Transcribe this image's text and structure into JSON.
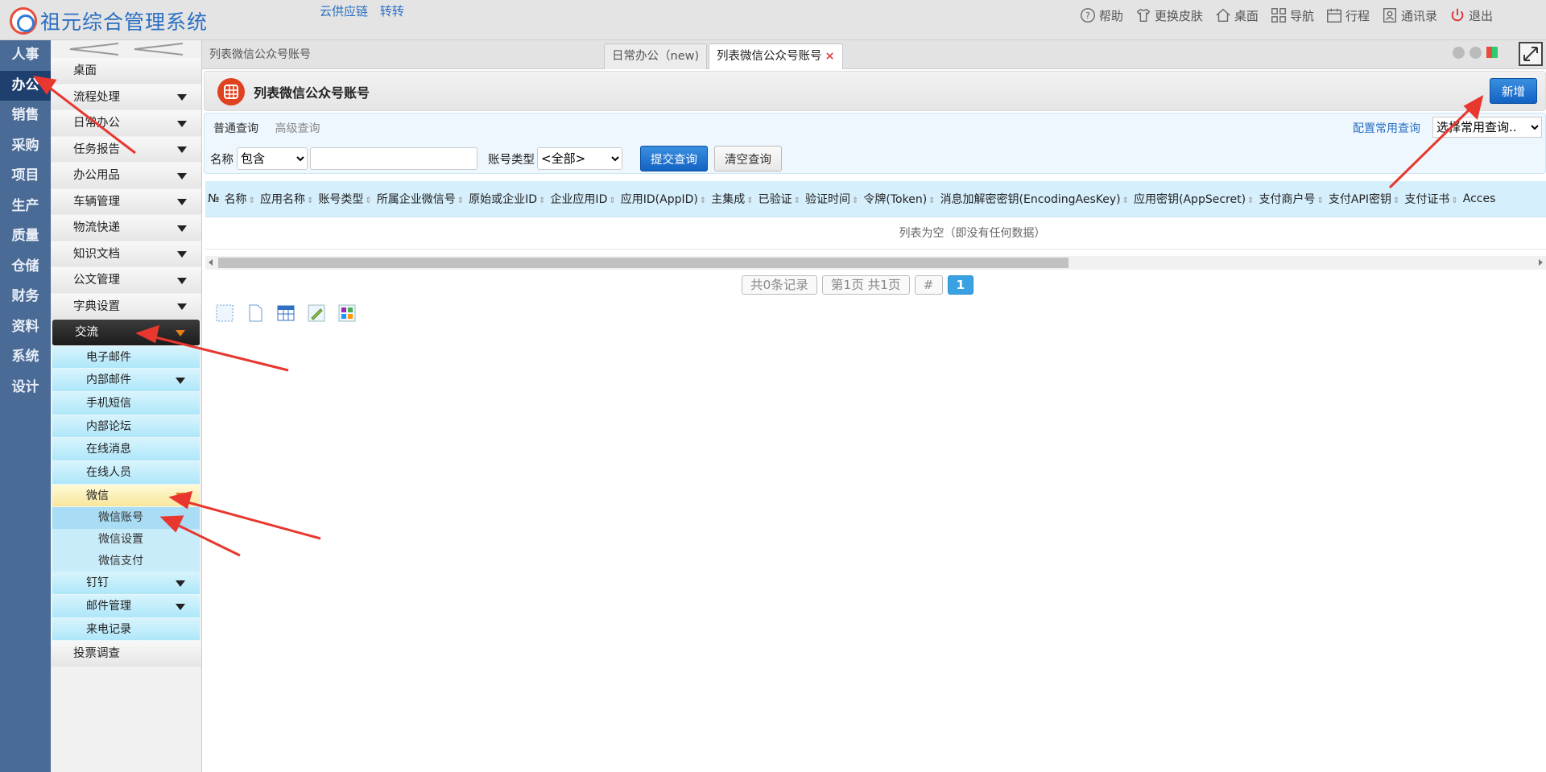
{
  "app": {
    "title": "祖元综合管理系统"
  },
  "top_links": [
    "云供应链",
    "转转"
  ],
  "top_right": [
    {
      "label": "帮助",
      "icon": "help-icon"
    },
    {
      "label": "更换皮肤",
      "icon": "shirt-icon"
    },
    {
      "label": "桌面",
      "icon": "home-icon"
    },
    {
      "label": "导航",
      "icon": "grid-icon"
    },
    {
      "label": "行程",
      "icon": "calendar-icon"
    },
    {
      "label": "通讯录",
      "icon": "contacts-icon"
    },
    {
      "label": "退出",
      "icon": "power-icon"
    }
  ],
  "left_nav": [
    "人事",
    "办公",
    "销售",
    "采购",
    "项目",
    "生产",
    "质量",
    "仓储",
    "财务",
    "资料",
    "系统",
    "设计"
  ],
  "left_nav_active": "办公",
  "menu": {
    "items": [
      "桌面",
      "流程处理",
      "日常办公",
      "任务报告",
      "办公用品",
      "车辆管理",
      "物流快递",
      "知识文档",
      "公文管理",
      "字典设置"
    ],
    "exchange": "交流",
    "exchange_sub": [
      "电子邮件",
      "内部邮件",
      "手机短信",
      "内部论坛",
      "在线消息",
      "在线人员"
    ],
    "wechat": "微信",
    "wechat_sub": [
      "微信账号",
      "微信设置",
      "微信支付"
    ],
    "after": [
      "钉钉",
      "邮件管理",
      "来电记录"
    ],
    "last": "投票调查"
  },
  "breadcrumb": "列表微信公众号账号",
  "tabs": [
    {
      "label": "日常办公（new)"
    },
    {
      "label": "列表微信公众号账号",
      "close": "×"
    }
  ],
  "header": {
    "title": "列表微信公众号账号",
    "new_label": "新增"
  },
  "query": {
    "tab_normal": "普通查询",
    "tab_advanced": "高级查询",
    "config_label": "配置常用查询",
    "common_select": "选择常用查询..",
    "name_label": "名称",
    "name_op": "包含",
    "name_value": "",
    "type_label": "账号类型",
    "type_value": "<全部>",
    "submit": "提交查询",
    "clear": "清空查询"
  },
  "table": {
    "columns": [
      "№",
      "名称",
      "应用名称",
      "账号类型",
      "所属企业微信号",
      "原始或企业ID",
      "企业应用ID",
      "应用ID(AppID)",
      "主集成",
      "已验证",
      "验证时间",
      "令牌(Token)",
      "消息加解密密钥(EncodingAesKey)",
      "应用密钥(AppSecret)",
      "支付商户号",
      "支付API密钥",
      "支付证书",
      "Acces"
    ],
    "empty_text": "列表为空（即没有任何数据）"
  },
  "pager": {
    "records": "共0条记录",
    "pages": "第1页 共1页",
    "hash": "#",
    "current": "1"
  },
  "colors": {
    "nav_bg": "#4a6b96",
    "accent": "#1363c4",
    "header_icon": "#e0421f"
  }
}
